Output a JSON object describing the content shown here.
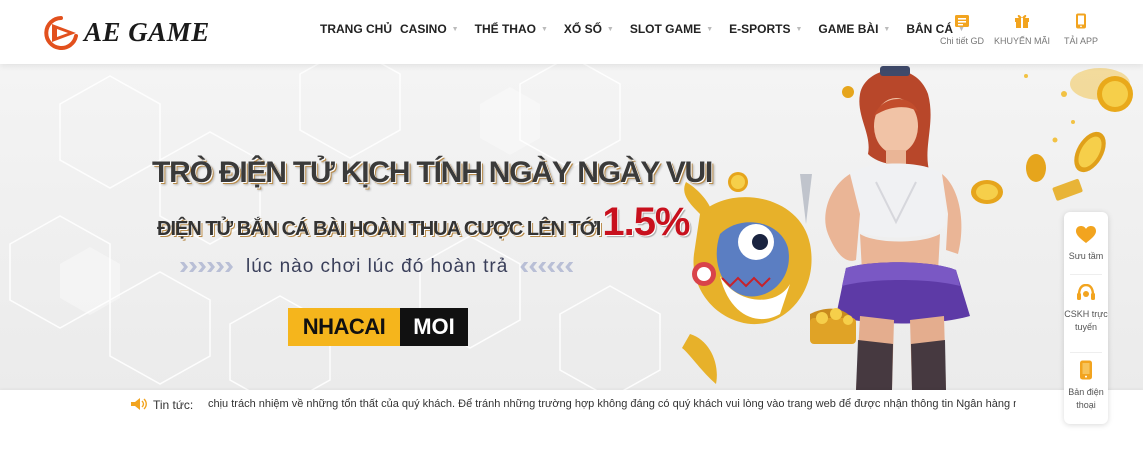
{
  "brand": {
    "name": "AE GAME",
    "accent": "#e2501d"
  },
  "nav": [
    {
      "label": "TRANG CHỦ",
      "caret": false
    },
    {
      "label": "CASINO",
      "caret": true
    },
    {
      "label": "THỂ THAO",
      "caret": true
    },
    {
      "label": "XỔ SỐ",
      "caret": true
    },
    {
      "label": "SLOT GAME",
      "caret": true
    },
    {
      "label": "E-SPORTS",
      "caret": true
    },
    {
      "label": "GAME BÀI",
      "caret": true
    },
    {
      "label": "BẮN CÁ",
      "caret": true
    }
  ],
  "utilities": [
    {
      "label": "Chi tiết GD",
      "icon": "transaction-details-icon"
    },
    {
      "label": "KHUYẾN MÃI",
      "icon": "gift-icon"
    },
    {
      "label": "TẢI APP",
      "icon": "mobile-icon"
    }
  ],
  "banner": {
    "headline": "TRÒ  ĐIỆN TỬ KỊCH TÍNH NGÀY NGÀY VUI",
    "subline": "ĐIỆN TỬ BẮN CÁ BÀI HOÀN THUA CƯỢC LÊN TỚI",
    "percent": "1.5%",
    "tagline": "lúc nào chơi lúc đó hoàn trả",
    "percent_color": "#c8101d"
  },
  "watermark": {
    "left": "NHACAI",
    "right": "MOI",
    "left_color": "#f5b51c",
    "right_color": "#111111"
  },
  "ticker": {
    "label": "Tin tức:",
    "text": "chịu trách nhiệm về những tổn thất của quý khách. Để tránh những trường hợp không đáng có quý khách vui lòng vào trang web để được nhận thông tin Ngân hàng nhận tiền"
  },
  "side": [
    {
      "label": "Sưu tầm",
      "icon": "heart-icon"
    },
    {
      "label": "CSKH trực tuyến",
      "icon": "headset-icon"
    },
    {
      "label": "Bản điện thoại",
      "icon": "phone-icon"
    }
  ]
}
